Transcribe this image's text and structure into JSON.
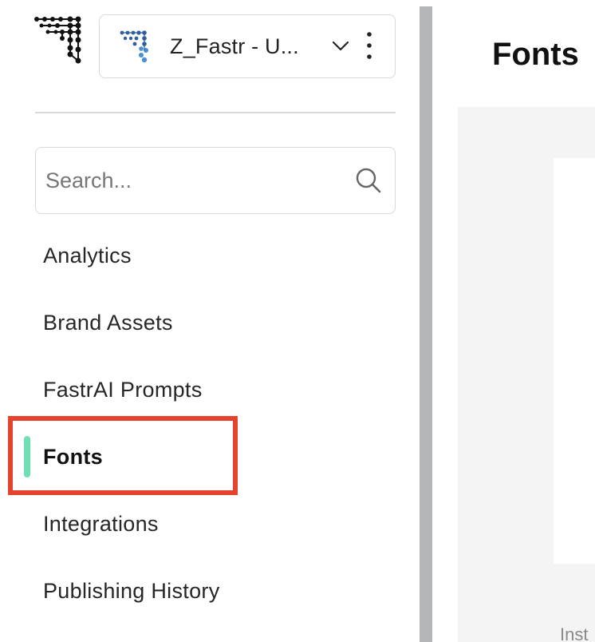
{
  "workspace": {
    "name": "Z_Fastr - U..."
  },
  "search": {
    "placeholder": "Search..."
  },
  "nav": {
    "items": [
      {
        "label": "Analytics"
      },
      {
        "label": "Brand Assets"
      },
      {
        "label": "FastrAI Prompts"
      },
      {
        "label": "Fonts",
        "active": true
      },
      {
        "label": "Integrations"
      },
      {
        "label": "Publishing History"
      }
    ]
  },
  "main": {
    "title": "Fonts",
    "footer_text": "Inst"
  },
  "colors": {
    "active_indicator": "#6ee0b4",
    "highlight_border": "#e5432e",
    "scrollbar": "#b5b6ba",
    "content_background": "#f4f4f4"
  },
  "icons": [
    "fastr-logo-icon",
    "workspace-logo-icon",
    "chevron-down-icon",
    "more-vertical-icon",
    "search-icon"
  ]
}
